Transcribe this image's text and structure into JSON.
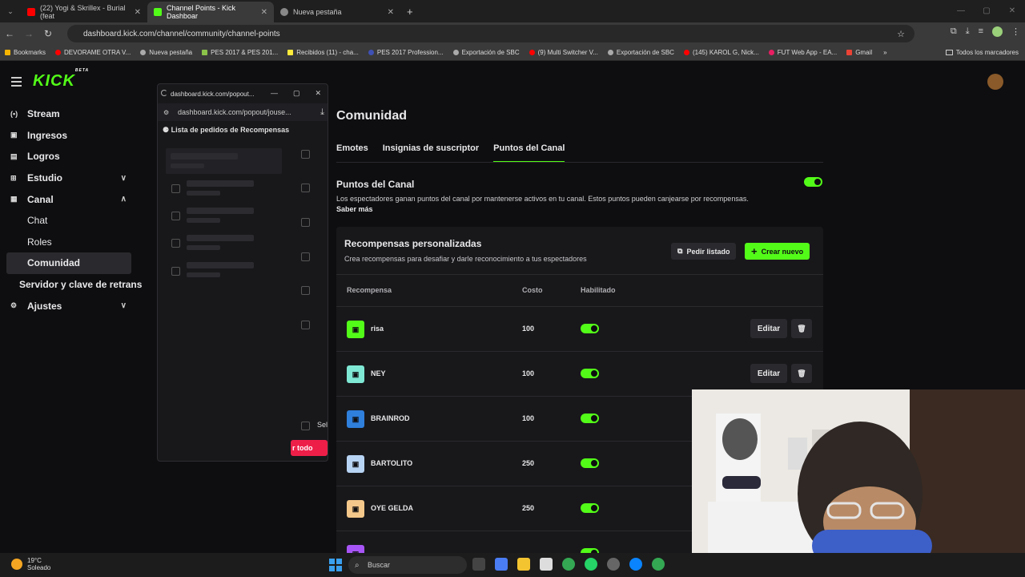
{
  "browser": {
    "tabs": [
      {
        "label": "(22) Yogi & Skrillex - Burial (feat",
        "color": "#ff0000"
      },
      {
        "label": "Channel Points - Kick Dashboar",
        "color": "#53fc18"
      },
      {
        "label": "Nueva pestaña",
        "color": "#888888"
      }
    ],
    "url": "dashboard.kick.com/channel/community/channel-points",
    "bookmarks": [
      "Bookmarks",
      "DEVORAME OTRA V...",
      "Nueva pestaña",
      "PES 2017 & PES 201...",
      "Recibidos (11) - cha...",
      "PES 2017 Profession...",
      "Exportación de SBC",
      "(9) Multi Switcher V...",
      "Exportación de SBC",
      "(145) KAROL G, Nick...",
      "FUT Web App - EA...",
      "Gmail"
    ],
    "bookmarks_right": "Todos los marcadores"
  },
  "app": {
    "logo": "KICK",
    "logo_badge": "BETA",
    "sidebar": [
      {
        "label": "Stream",
        "icon": "(•)"
      },
      {
        "label": "Ingresos",
        "icon": "▣"
      },
      {
        "label": "Logros",
        "icon": "▤"
      },
      {
        "label": "Estudio",
        "icon": "⊞",
        "chev": "∨"
      },
      {
        "label": "Canal",
        "icon": "▦",
        "chev": "∧"
      }
    ],
    "sidebar_sub": [
      "Chat",
      "Roles",
      "Comunidad"
    ],
    "sidebar_plain": "Servidor y clave de retrans",
    "sidebar_settings": {
      "label": "Ajustes",
      "icon": "⚙",
      "chev": "∨"
    },
    "page_title": "Comunidad",
    "tabs": [
      "Emotes",
      "Insignias de suscriptor",
      "Puntos del Canal"
    ],
    "points": {
      "title": "Puntos del Canal",
      "desc": "Los espectadores ganan puntos del canal por mantenerse activos en tu canal. Estos puntos pueden canjearse por recompensas.",
      "more": "Saber más"
    },
    "rewards": {
      "title": "Recompensas personalizadas",
      "subtitle": "Crea recompensas para desafiar y darle reconocimiento a tus espectadores",
      "list_button": "Pedir listado",
      "new_button": "Crear nuevo",
      "headers": {
        "reward": "Recompensa",
        "cost": "Costo",
        "enabled": "Habilitado"
      },
      "edit_label": "Editar",
      "rows": [
        {
          "name": "risa",
          "cost": "100",
          "color": "#53fc18"
        },
        {
          "name": "NEY",
          "cost": "100",
          "color": "#7fe8d4"
        },
        {
          "name": "BRAINROD",
          "cost": "100",
          "color": "#2f7fdc"
        },
        {
          "name": "BARTOLITO",
          "cost": "250",
          "color": "#b8d4f4"
        },
        {
          "name": "OYE GELDA",
          "cost": "250",
          "color": "#f4c88a"
        }
      ]
    }
  },
  "popup": {
    "title": "dashboard.kick.com/popout...",
    "url": "dashboard.kick.com/popout/jouse...",
    "heading": "Lista de pedidos de Recompensas",
    "select_label": "Sel",
    "footer_button": "r todo"
  },
  "taskbar": {
    "temp": "19°C",
    "weather": "Soleado",
    "search": "Buscar"
  }
}
